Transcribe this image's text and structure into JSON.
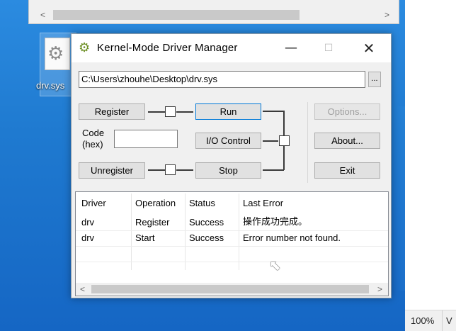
{
  "background_window": {
    "scroll_left_icon": "chevron-left-icon",
    "scroll_right_icon": "chevron-right-icon"
  },
  "desktop_icon": {
    "label": "drv.sys",
    "icon": "gear-file-icon"
  },
  "right_app": {
    "zoom": "100%",
    "tail_text": "V"
  },
  "dialog": {
    "title": "Kernel-Mode Driver Manager",
    "app_icon": "gears-icon",
    "minimize_label": "—",
    "maximize_label": "☐",
    "close_label": "✕",
    "path_value": "C:\\Users\\zhouhe\\Desktop\\drv.sys",
    "browse_label": "...",
    "buttons": {
      "register": "Register",
      "unregister": "Unregister",
      "run": "Run",
      "io_control": "I/O Control",
      "stop": "Stop",
      "options": "Options...",
      "about": "About...",
      "exit": "Exit"
    },
    "code_label_line1": "Code",
    "code_label_line2": "(hex)",
    "code_value": ""
  },
  "log": {
    "columns": [
      "Driver",
      "Operation",
      "Status",
      "Last Error"
    ],
    "rows": [
      [
        "drv",
        "Register",
        "Success",
        "操作成功完成。"
      ],
      [
        "drv",
        "Start",
        "Success",
        "Error number not found."
      ]
    ]
  },
  "colors": {
    "desktop": "#1f7ad0",
    "focus_border": "#0078d7",
    "dialog_bg": "#f0f0f0"
  }
}
